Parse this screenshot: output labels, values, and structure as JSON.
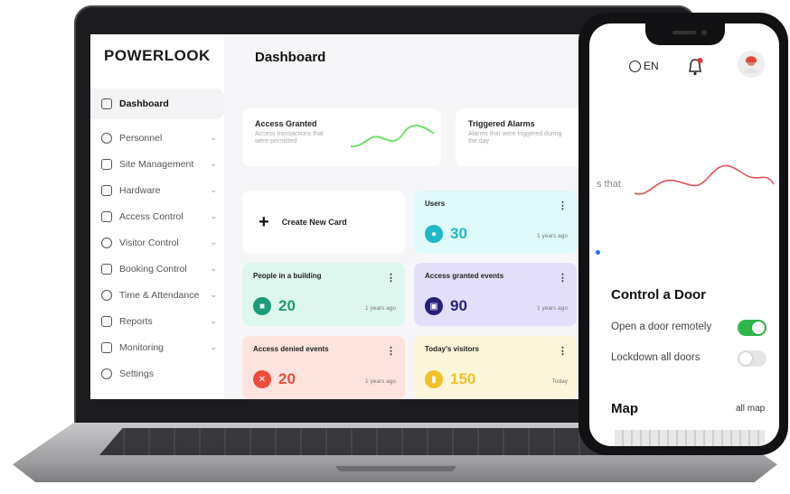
{
  "app": {
    "logo": "POWERLOOK"
  },
  "sidebar": {
    "items": [
      {
        "label": "Dashboard",
        "icon": "grid-icon",
        "active": true
      },
      {
        "label": "Personnel",
        "icon": "people-icon",
        "chevron": true
      },
      {
        "label": "Site Management",
        "icon": "sitemap-icon",
        "chevron": true
      },
      {
        "label": "Hardware",
        "icon": "hardware-icon",
        "chevron": true
      },
      {
        "label": "Access Control",
        "icon": "keypad-icon",
        "chevron": true
      },
      {
        "label": "Visitor Control",
        "icon": "visitor-icon",
        "chevron": true
      },
      {
        "label": "Booking Control",
        "icon": "booking-icon",
        "chevron": true
      },
      {
        "label": "Time & Attendance",
        "icon": "clock-icon",
        "chevron": true
      },
      {
        "label": "Reports",
        "icon": "report-icon",
        "chevron": true
      },
      {
        "label": "Monitoring",
        "icon": "monitor-icon",
        "chevron": true
      },
      {
        "label": "Settings",
        "icon": "gear-icon",
        "chevron": false
      }
    ]
  },
  "main": {
    "title": "Dashboard",
    "panels": [
      {
        "title": "Access Granted",
        "subtitle": "Access transactions that were permitted"
      },
      {
        "title": "Triggered Alarms",
        "subtitle": "Alarms that were triggered during the day"
      }
    ],
    "create_card": "Create New Card",
    "cards": [
      {
        "title": "Users",
        "value": "30",
        "ago": "1 years ago",
        "color": "#1fb8c9",
        "bg": "#dffafa",
        "icon": "users-icon"
      },
      {
        "title": "People in a building",
        "value": "20",
        "ago": "1 years ago",
        "color": "#1b9b78",
        "bg": "#def7ee",
        "icon": "building-icon"
      },
      {
        "title": "Access granted events",
        "value": "90",
        "ago": "1 years ago",
        "color": "#25207a",
        "bg": "#e3defa",
        "icon": "lock-icon"
      },
      {
        "title": "Access denied events",
        "value": "20",
        "ago": "1 years ago",
        "color": "#ef4b3c",
        "bg": "#fde3de",
        "icon": "denied-icon"
      },
      {
        "title": "Today's visitors",
        "value": "150",
        "ago": "Today",
        "color": "#f2c027",
        "bg": "#fdf6da",
        "icon": "visitor-badge-icon"
      }
    ]
  },
  "phone": {
    "language": "EN",
    "partial_text": "s that",
    "control_title": "Control a Door",
    "controls": [
      {
        "label": "Open a door remotely",
        "on": true
      },
      {
        "label": "Lockdown all doors",
        "on": false
      }
    ],
    "map_title": "Map",
    "map_link": "all map"
  },
  "colors": {
    "accent_green": "#2fb84a",
    "chart_green": "#6fe06a",
    "chart_red": "#e05252"
  }
}
